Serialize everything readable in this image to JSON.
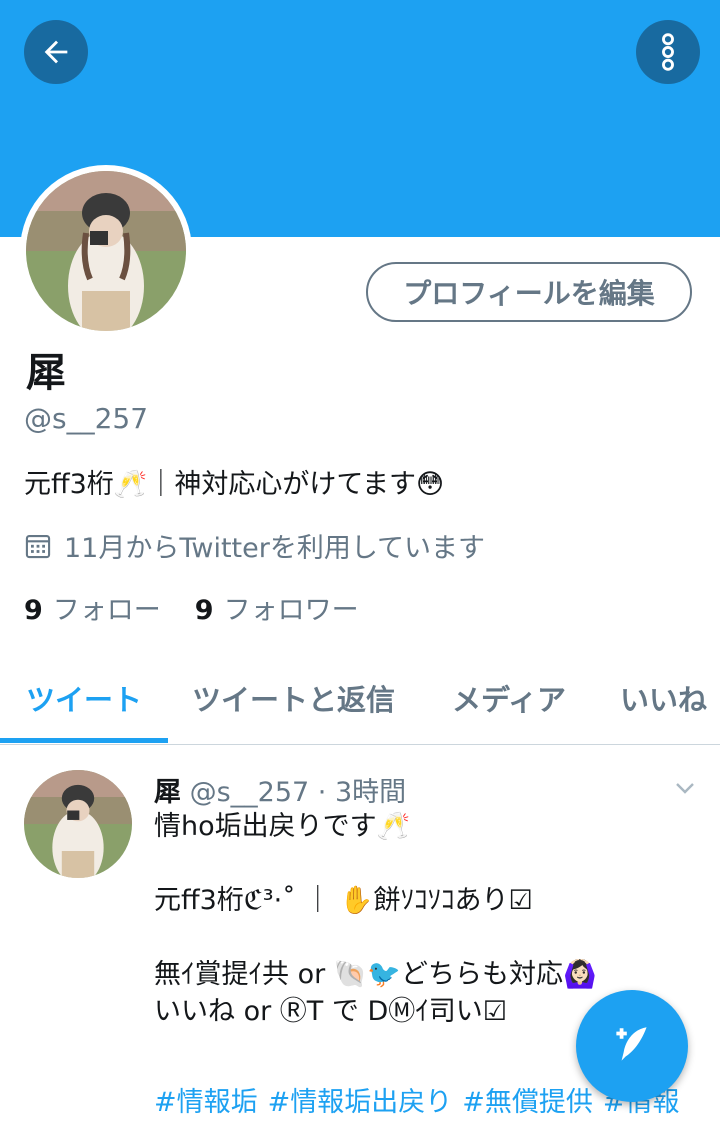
{
  "header": {
    "back_icon": "arrow-left-icon",
    "more_icon": "more-vertical-icon",
    "banner_color": "#1da1f2"
  },
  "profile": {
    "edit_button_label": "プロフィールを編集",
    "display_name": "犀",
    "handle": "@s__257",
    "bio": "元ff3桁🥂｜神対応心がけてます😳",
    "joined_icon": "calendar-icon",
    "joined": "11月からTwitterを利用しています",
    "following_count": "9",
    "following_label": "フォロー",
    "followers_count": "9",
    "followers_label": "フォロワー"
  },
  "tabs": [
    {
      "label": "ツイート",
      "active": true
    },
    {
      "label": "ツイートと返信",
      "active": false
    },
    {
      "label": "メディア",
      "active": false
    },
    {
      "label": "いいね",
      "active": false
    }
  ],
  "tweet": {
    "name": "犀",
    "handle": "@s__257",
    "time": "· 3時間",
    "lines": [
      "情ho垢出戻りです🥂",
      "",
      "元ff3桁ℭ³·˚ ｜ ✋餅ｿｺｿｺあり☑",
      "",
      "無ｲ賞提ｲ共 or 🐚🐦どちらも対応🙆🏻‍♀️",
      "いいね or ⓇT で DⓂｲ司い☑"
    ],
    "hashtags": [
      "#情報垢",
      "#情報垢出戻り",
      "#無償提供",
      "#情報"
    ]
  },
  "fab": {
    "icon": "compose-tweet-icon"
  },
  "colors": {
    "accent": "#1da1f2",
    "secondary_text": "#657786",
    "primary_text": "#14171a"
  }
}
